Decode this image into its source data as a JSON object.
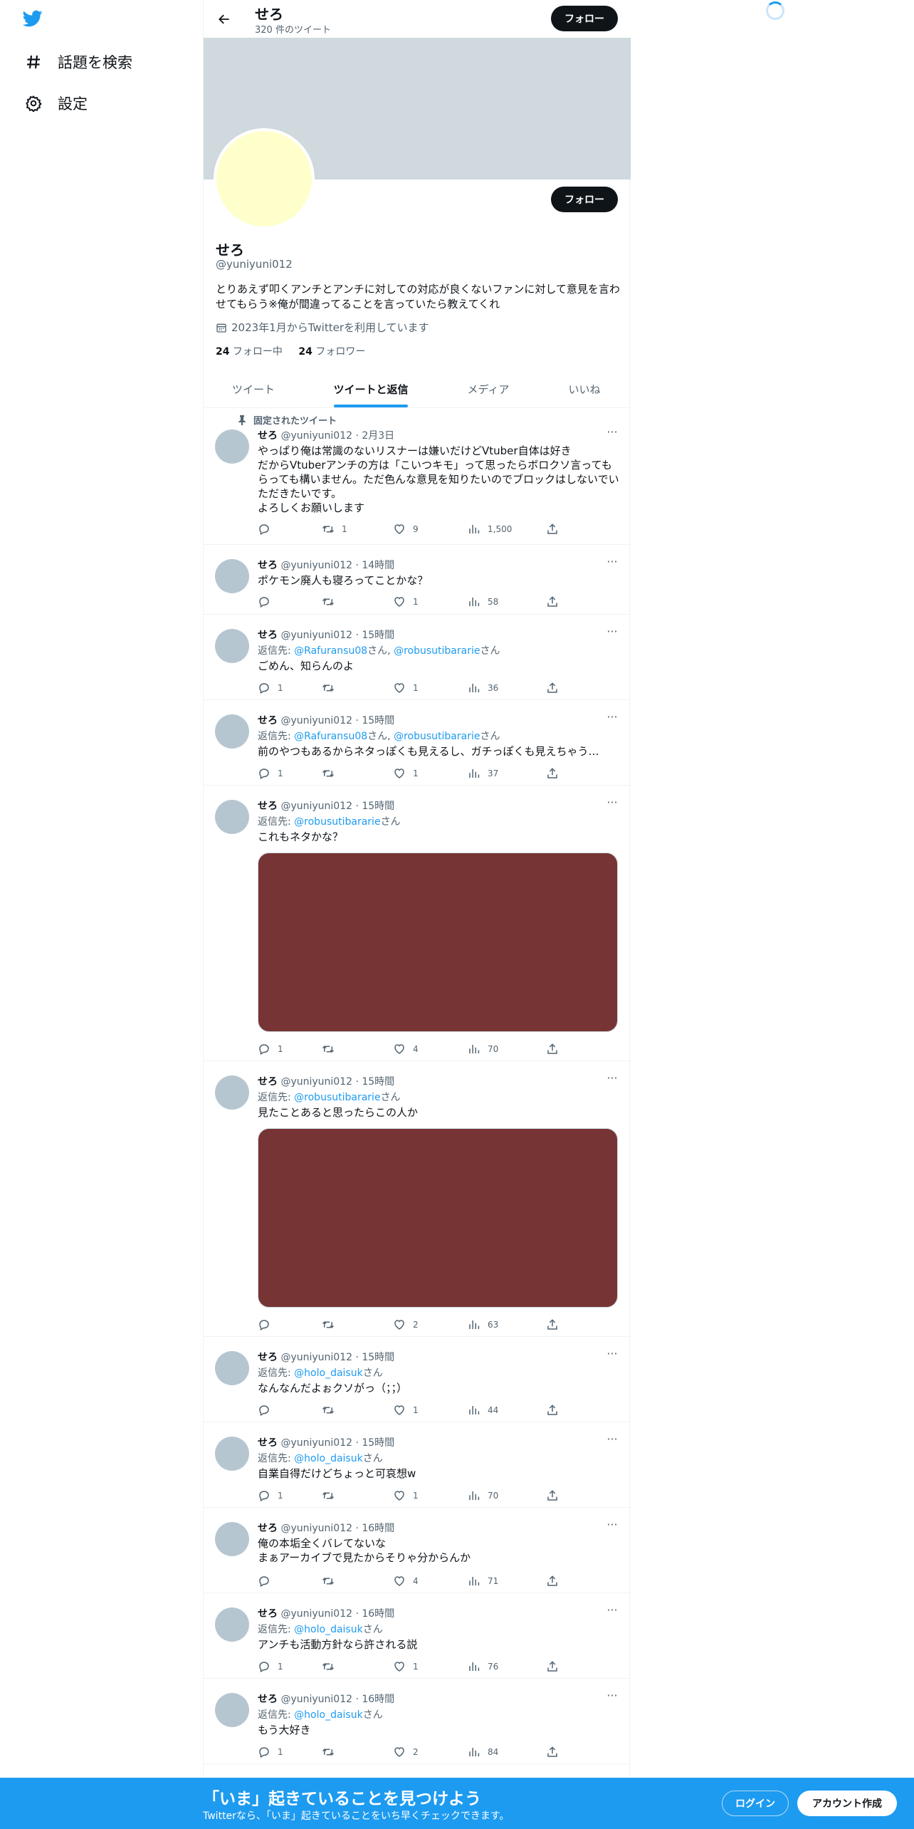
{
  "sidebar": {
    "logo_icon": "twitter-bird-icon",
    "items": [
      {
        "label": "話題を検索",
        "icon": "hashtag-icon"
      },
      {
        "label": "設定",
        "icon": "gear-icon"
      }
    ]
  },
  "header": {
    "name": "せろ",
    "tweet_count": "320 件のツイート",
    "follow_label": "フォロー"
  },
  "profile": {
    "name": "せろ",
    "handle": "@yuniyuni012",
    "bio": "とりあえず叩くアンチとアンチに対しての対応が良くないファンに対して意見を言わせてもらう※俺が間違ってることを言っていたら教えてくれ",
    "joined": "2023年1月からTwitterを利用しています",
    "following_count": "24",
    "following_label": " フォロー中",
    "followers_count": "24",
    "followers_label": " フォロワー",
    "follow_label": "フォロー",
    "avatar_color": "#ffffcc",
    "banner_color": "#cfd9de"
  },
  "tabs": [
    "ツイート",
    "ツイートと返信",
    "メディア",
    "いいね"
  ],
  "active_tab": "ツイートと返信",
  "pinned_label": "固定されたツイート",
  "tweets": [
    {
      "name": "せろ",
      "meta": " @yuniyuni012 · 2月3日",
      "reply_to": null,
      "text": "やっぱり俺は常識のないリスナーは嫌いだけどVtuber自体は好き\nだからVtuberアンチの方は「こいつキモ」って思ったらボロクソ言ってもらっても構いません。ただ色んな意見を知りたいのでブロックはしないでいただきたいです。\nよろしくお願いします",
      "replies": "",
      "retweets": "1",
      "likes": "9",
      "views": "1,500"
    },
    {
      "name": "せろ",
      "meta": " @yuniyuni012 · 14時間",
      "reply_to": null,
      "text": "ポケモン廃人も寝ろってことかな？",
      "replies": "",
      "retweets": "",
      "likes": "1",
      "views": "58"
    },
    {
      "name": "せろ",
      "meta": " @yuniyuni012 · 15時間",
      "reply_prefix": "返信先: ",
      "reply_mentions": [
        "@Rafuransu08",
        "@robusutibararie"
      ],
      "text": "ごめん、知らんのよ",
      "replies": "1",
      "retweets": "",
      "likes": "1",
      "views": "36"
    },
    {
      "name": "せろ",
      "meta": " @yuniyuni012 · 15時間",
      "reply_prefix": "返信先: ",
      "reply_mentions": [
        "@Rafuransu08",
        "@robusutibararie"
      ],
      "text": "前のやつもあるからネタっぽくも見えるし、ガチっぽくも見えちゃう…",
      "replies": "1",
      "retweets": "",
      "likes": "1",
      "views": "37"
    },
    {
      "name": "せろ",
      "meta": " @yuniyuni012 · 15時間",
      "reply_prefix": "返信先: ",
      "reply_mentions": [
        "@robusutibararie"
      ],
      "text": "これもネタかな？",
      "media_color": "#763434",
      "replies": "1",
      "retweets": "",
      "likes": "4",
      "views": "70"
    },
    {
      "name": "せろ",
      "meta": " @yuniyuni012 · 15時間",
      "reply_prefix": "返信先: ",
      "reply_mentions": [
        "@robusutibararie"
      ],
      "text": "見たことあると思ったらこの人か",
      "media_color": "#763434",
      "replies": "",
      "retweets": "",
      "likes": "2",
      "views": "63"
    },
    {
      "name": "せろ",
      "meta": " @yuniyuni012 · 15時間",
      "reply_prefix": "返信先: ",
      "reply_mentions": [
        "@holo_daisuk"
      ],
      "text": "なんなんだよぉクソがっ（；；）",
      "replies": "",
      "retweets": "",
      "likes": "1",
      "views": "44"
    },
    {
      "name": "せろ",
      "meta": " @yuniyuni012 · 15時間",
      "reply_prefix": "返信先: ",
      "reply_mentions": [
        "@holo_daisuk"
      ],
      "text": "自業自得だけどちょっと可哀想w",
      "replies": "1",
      "retweets": "",
      "likes": "1",
      "views": "70"
    },
    {
      "name": "せろ",
      "meta": " @yuniyuni012 · 16時間",
      "reply_to": null,
      "text": "俺の本垢全くバレてないな\nまぁアーカイブで見たからそりゃ分からんか",
      "replies": "",
      "retweets": "",
      "likes": "4",
      "views": "71"
    },
    {
      "name": "せろ",
      "meta": " @yuniyuni012 · 16時間",
      "reply_prefix": "返信先: ",
      "reply_mentions": [
        "@holo_daisuk"
      ],
      "text": "アンチも活動方針なら許される説",
      "replies": "1",
      "retweets": "",
      "likes": "1",
      "views": "76"
    },
    {
      "name": "せろ",
      "meta": " @yuniyuni012 · 16時間",
      "reply_prefix": "返信先: ",
      "reply_mentions": [
        "@holo_daisuk"
      ],
      "text": "もう大好き",
      "replies": "1",
      "retweets": "",
      "likes": "2",
      "views": "84"
    }
  ],
  "mention_suffix": "さん",
  "mention_separator": ", ",
  "bottom_bar": {
    "title": "「いま」起きていることを見つけよう",
    "subtitle": "Twitterなら、「いま」起きていることをいち早くチェックできます。",
    "login": "ログイン",
    "signup": "アカウント作成",
    "color": "#1d9bf0"
  }
}
